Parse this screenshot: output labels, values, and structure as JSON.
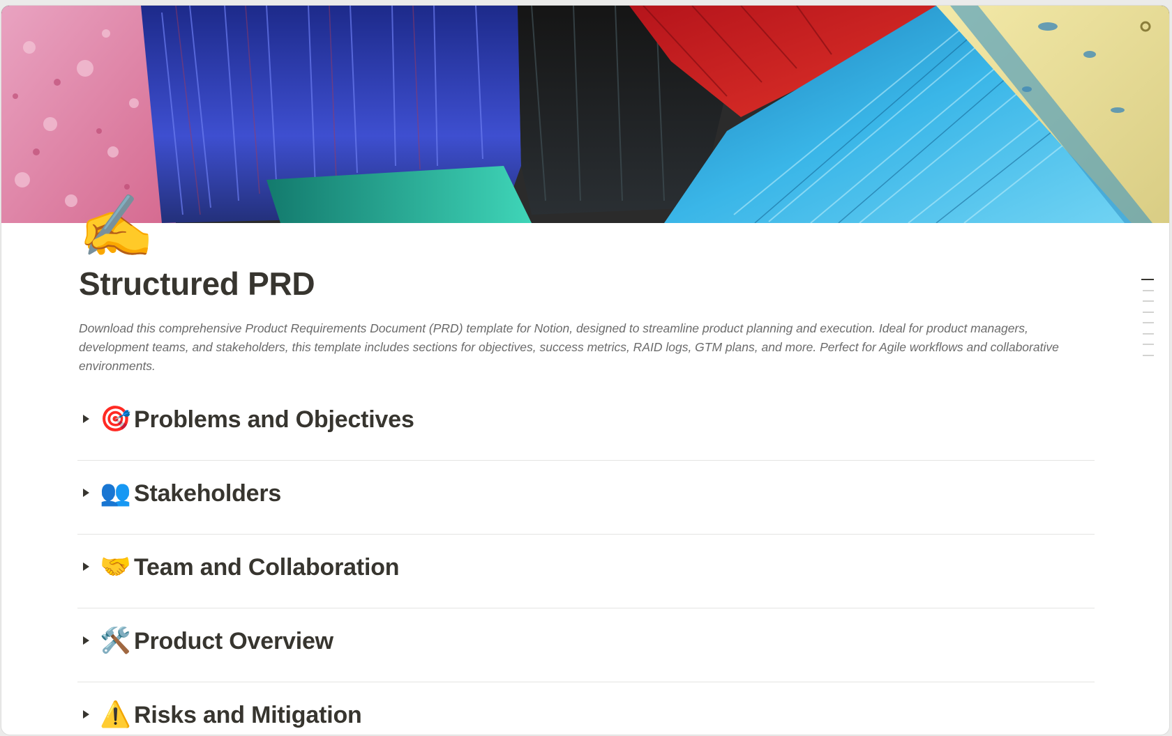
{
  "page": {
    "icon": "✍️",
    "icon_name": "writing-hand-icon",
    "title": "Structured PRD",
    "description": "Download this comprehensive Product Requirements Document (PRD) template for Notion, designed to streamline product planning and execution. Ideal for product managers, development teams, and stakeholders, this template includes sections for objectives, success metrics, RAID logs, GTM plans, and more. Perfect for Agile workflows and collaborative environments."
  },
  "toggles": [
    {
      "emoji": "🎯",
      "icon_name": "target-icon",
      "label": "Problems and Objectives"
    },
    {
      "emoji": "👥",
      "icon_name": "people-icon",
      "label": "Stakeholders"
    },
    {
      "emoji": "🤝",
      "icon_name": "handshake-icon",
      "label": "Team and Collaboration"
    },
    {
      "emoji": "🛠️",
      "icon_name": "tools-icon",
      "label": "Product Overview"
    },
    {
      "emoji": "⚠️",
      "icon_name": "warning-icon",
      "label": "Risks and Mitigation"
    }
  ],
  "colors": {
    "text": "#37352f",
    "muted": "#6b6b6b",
    "divider": "#e4e4e2"
  }
}
